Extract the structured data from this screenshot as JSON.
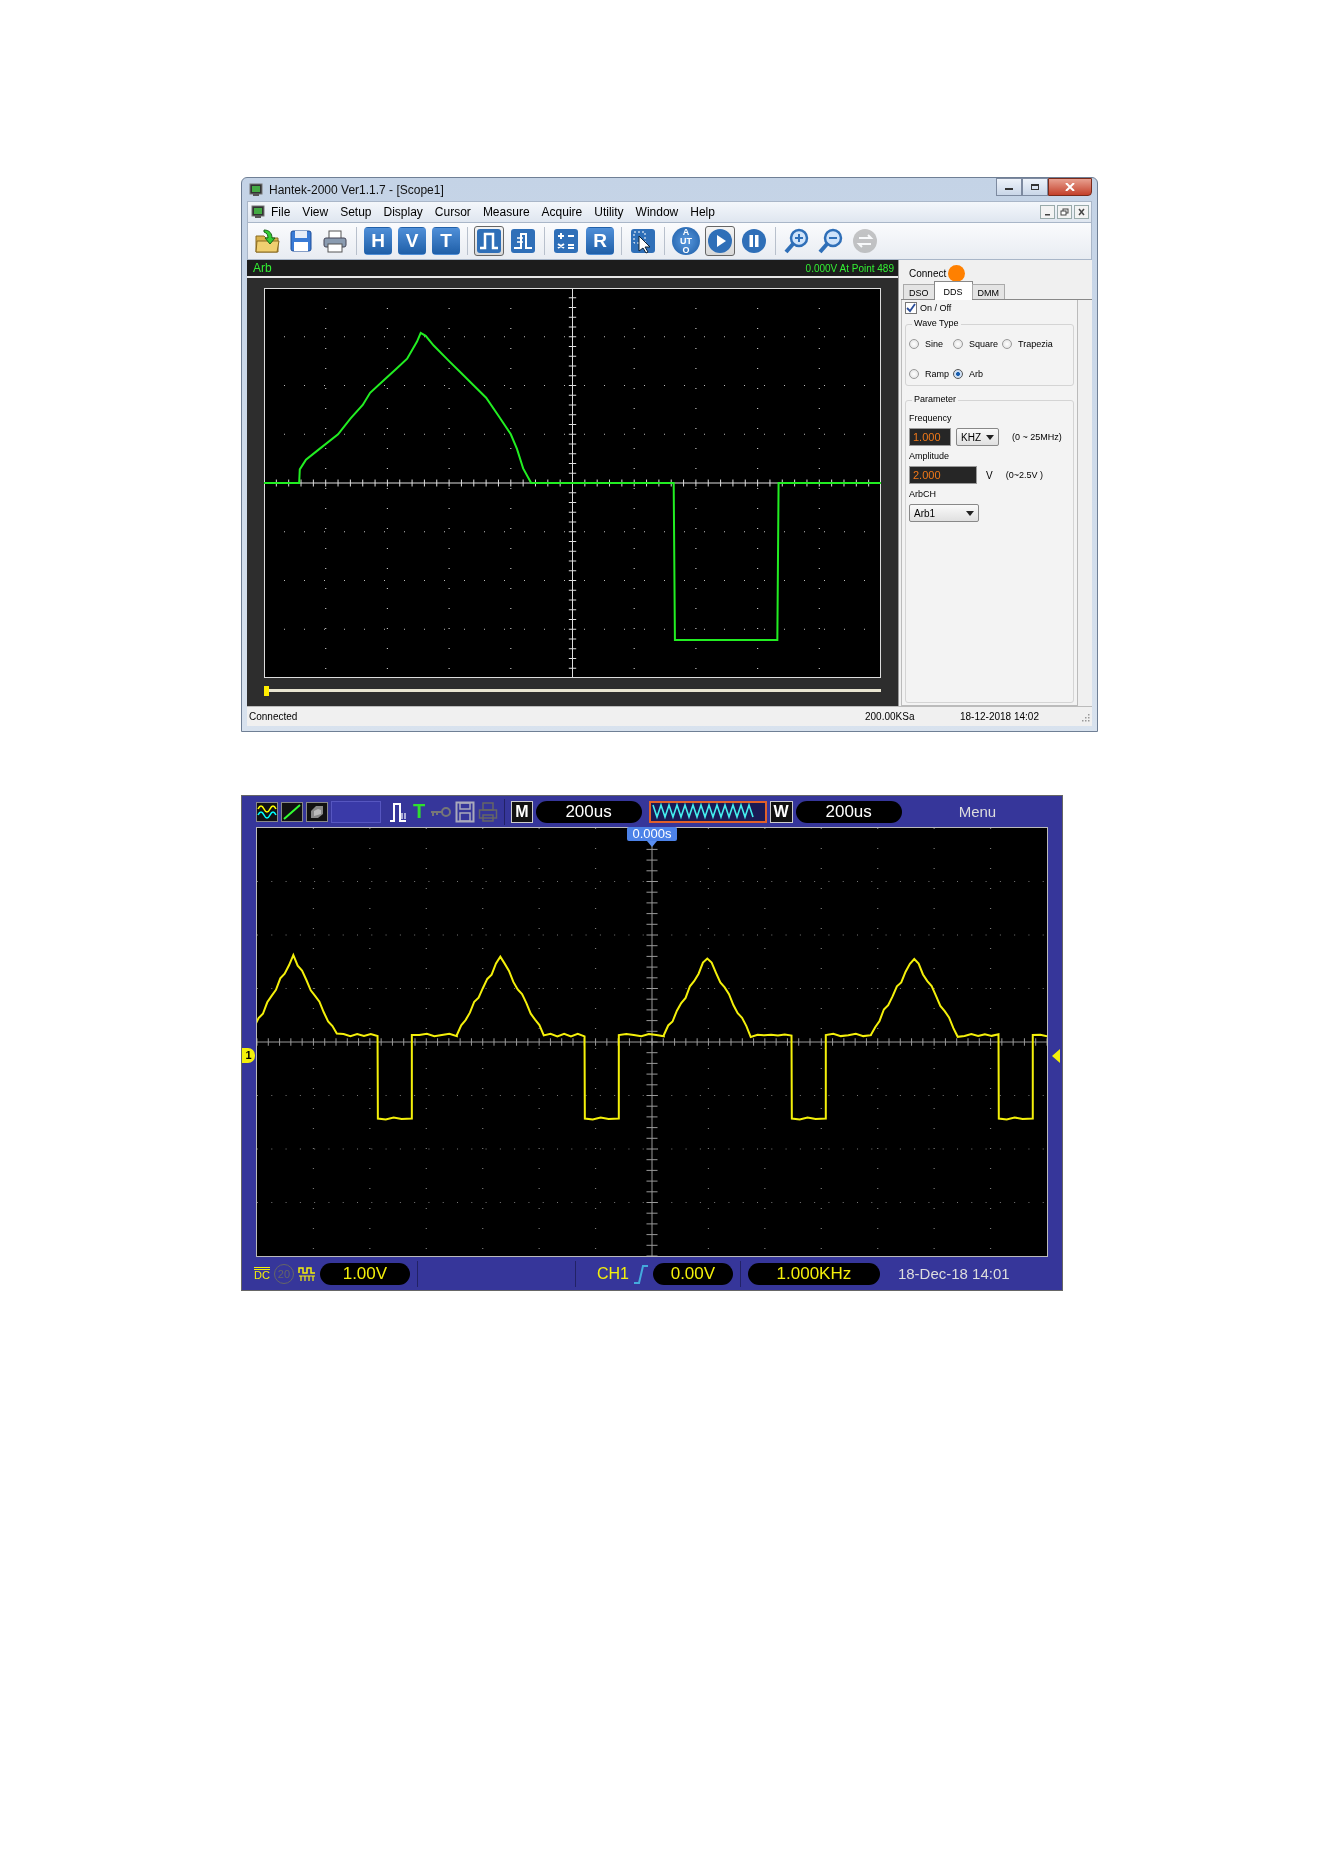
{
  "pc_software": {
    "window": {
      "title": "Hantek-2000 Ver1.1.7 - [Scope1]"
    },
    "menu": [
      "File",
      "View",
      "Setup",
      "Display",
      "Cursor",
      "Measure",
      "Acquire",
      "Utility",
      "Window",
      "Help"
    ],
    "toolbar": [
      [
        {
          "kind": "open",
          "pressed": false,
          "disabled": false
        },
        {
          "kind": "save",
          "pressed": false,
          "disabled": false
        },
        {
          "kind": "print",
          "pressed": false,
          "disabled": false
        }
      ],
      [
        {
          "kind": "letter",
          "text": "H",
          "pressed": false,
          "disabled": false
        },
        {
          "kind": "letter",
          "text": "V",
          "pressed": false,
          "disabled": false
        },
        {
          "kind": "letter",
          "text": "T",
          "pressed": false,
          "disabled": false
        }
      ],
      [
        {
          "kind": "square",
          "pressed": true,
          "disabled": false
        },
        {
          "kind": "step",
          "pressed": false,
          "disabled": false
        }
      ],
      [
        {
          "kind": "math",
          "pressed": false,
          "disabled": false
        },
        {
          "kind": "letter",
          "text": "R",
          "pressed": false,
          "disabled": false
        }
      ],
      [
        {
          "kind": "pointer",
          "pressed": false,
          "disabled": false
        }
      ],
      [
        {
          "kind": "round-text",
          "text": "AUTO",
          "pressed": false,
          "disabled": false
        },
        {
          "kind": "play",
          "pressed": true,
          "disabled": false
        },
        {
          "kind": "pause",
          "pressed": false,
          "disabled": false
        }
      ],
      [
        {
          "kind": "zoom-in",
          "pressed": false,
          "disabled": false
        },
        {
          "kind": "zoom-out",
          "pressed": false,
          "disabled": false
        },
        {
          "kind": "swap",
          "pressed": false,
          "disabled": true
        }
      ]
    ],
    "position_slider": {
      "level": 0
    },
    "trace_label": "Arb",
    "readout": "0.000V At Point 489",
    "connect": {
      "label": "Connect",
      "connected": true
    },
    "tabs": [
      {
        "label": "DSO",
        "selected": false
      },
      {
        "label": "DDS",
        "selected": true
      },
      {
        "label": "DMM",
        "selected": false
      }
    ],
    "output": {
      "label": "On / Off",
      "checked": true
    },
    "wave_type": {
      "title": "Wave Type",
      "options": [
        {
          "label": "Sine",
          "selected": false
        },
        {
          "label": "Square",
          "selected": false
        },
        {
          "label": "Trapezia",
          "selected": false
        },
        {
          "label": "Ramp",
          "selected": false
        },
        {
          "label": "Arb",
          "selected": true
        }
      ]
    },
    "parameter": {
      "title": "Parameter",
      "frequency": {
        "label": "Frequency",
        "value": "1.000",
        "unit": "KHZ",
        "range": "(0 ~ 25MHz)"
      },
      "amplitude": {
        "label": "Amplitude",
        "value": "2.000",
        "unit": "V",
        "range": "(0~2.5V )"
      },
      "arb_channel": {
        "label": "ArbCH",
        "value": "Arb1"
      }
    },
    "status_bar": [
      "Connected",
      "200.00KSa",
      "18-12-2018  14:02"
    ]
  },
  "scope_screen": {
    "top_bar": {
      "trigger_letter": "T",
      "main_badge": "M",
      "main_timebase": "200us",
      "window_badge": "W",
      "window_timebase": "200us",
      "menu": "Menu"
    },
    "trigger_position": "0.000s",
    "channel_marker": "1",
    "bottom_bar": {
      "coupling": "DC",
      "bandwidth_limit": "20",
      "volts_per_div": "1.00V",
      "trigger_source": "CH1",
      "trigger_level": "0.00V",
      "frequency": "1.000KHz",
      "datetime": "18-Dec-18 14:01"
    }
  }
}
